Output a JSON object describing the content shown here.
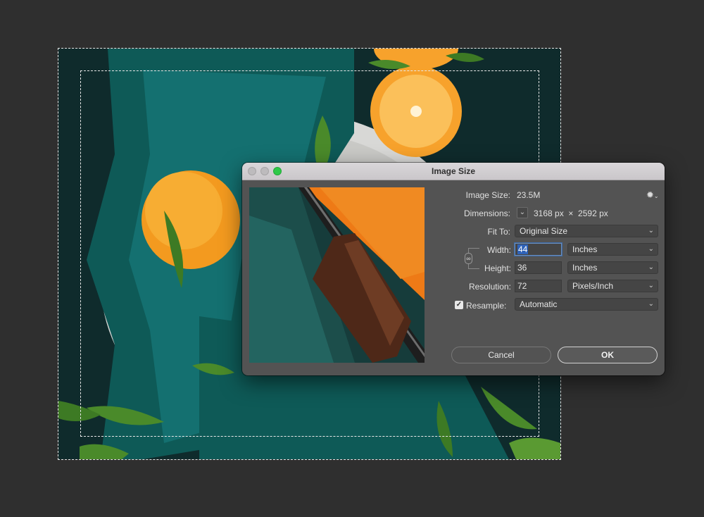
{
  "dialog": {
    "title": "Image Size",
    "image_size_label": "Image Size:",
    "image_size_value": "23.5M",
    "dimensions_label": "Dimensions:",
    "dimensions_value": "3168 px  ×  2592 px",
    "fit_to_label": "Fit To:",
    "fit_to_value": "Original Size",
    "width_label": "Width:",
    "width_value": "44",
    "width_unit": "Inches",
    "height_label": "Height:",
    "height_value": "36",
    "height_unit": "Inches",
    "resolution_label": "Resolution:",
    "resolution_value": "72",
    "resolution_unit": "Pixels/Inch",
    "resample_label": "Resample:",
    "resample_checked": true,
    "resample_value": "Automatic",
    "cancel_label": "Cancel",
    "ok_label": "OK"
  },
  "icons": {
    "gear": "gear-icon",
    "chain": "link-icon",
    "chevron": "chevron-down-icon",
    "dimensions": "chevron-down-icon",
    "check": "checkmark-icon"
  },
  "colors": {
    "canvas_bg": "#2f2f2f",
    "dialog_bg": "#535353",
    "titlebar": "#d0cdd0",
    "maximize": "#2ec948",
    "focus": "#2e62b8"
  }
}
